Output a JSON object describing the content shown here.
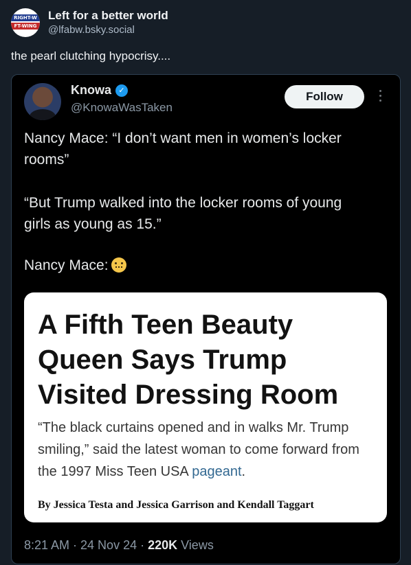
{
  "post": {
    "author_name": "Left for a better world",
    "author_handle": "@lfabw.bsky.social",
    "avatar_text_top": "RIGHT-W",
    "avatar_text_bottom": "FT-WING",
    "text": "the pearl clutching hypocrisy...."
  },
  "embed": {
    "name": "Knowa",
    "handle": "@KnowaWasTaken",
    "follow_label": "Follow",
    "paragraphs": [
      "Nancy Mace: “I don’t want men in women’s locker rooms”",
      "“But Trump walked into the locker rooms of young girls as young as 15.”",
      "Nancy Mace:"
    ],
    "emoji": "grimacing-face",
    "article": {
      "headline": "A Fifth Teen Beauty Queen Says Trump Visited Dressing Room",
      "dek_text": "“The black curtains opened and in walks Mr. Trump smiling,” said the latest woman to come forward from the 1997 Miss Teen USA",
      "dek_link": "pageant",
      "dek_end": ".",
      "byline": "By Jessica Testa and Jessica Garrison and Kendall Taggart"
    },
    "time": "8:21 AM · 24 Nov 24 · ",
    "views_count": "220K",
    "views_label": " Views"
  },
  "colors": {
    "page_bg": "#161e27",
    "embed_bg": "#000000",
    "verified": "#1d9bf0",
    "link": "#326891"
  }
}
